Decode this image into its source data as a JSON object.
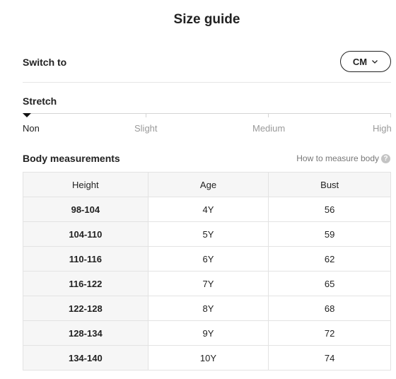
{
  "title": "Size guide",
  "switch": {
    "label": "Switch to",
    "unit": "CM"
  },
  "stretch": {
    "label": "Stretch",
    "levels": [
      "Non",
      "Slight",
      "Medium",
      "High"
    ],
    "selected": "Non"
  },
  "body_measurements": {
    "title": "Body measurements",
    "how_to_link": "How to measure body",
    "help_icon_text": "?",
    "headers": [
      "Height",
      "Age",
      "Bust"
    ],
    "rows": [
      [
        "98-104",
        "4Y",
        "56"
      ],
      [
        "104-110",
        "5Y",
        "59"
      ],
      [
        "110-116",
        "6Y",
        "62"
      ],
      [
        "116-122",
        "7Y",
        "65"
      ],
      [
        "122-128",
        "8Y",
        "68"
      ],
      [
        "128-134",
        "9Y",
        "72"
      ],
      [
        "134-140",
        "10Y",
        "74"
      ]
    ]
  },
  "colors": {
    "text": "#222222",
    "muted": "#9a9a9a",
    "border": "#e3e3e3",
    "header_bg": "#f6f6f6"
  }
}
